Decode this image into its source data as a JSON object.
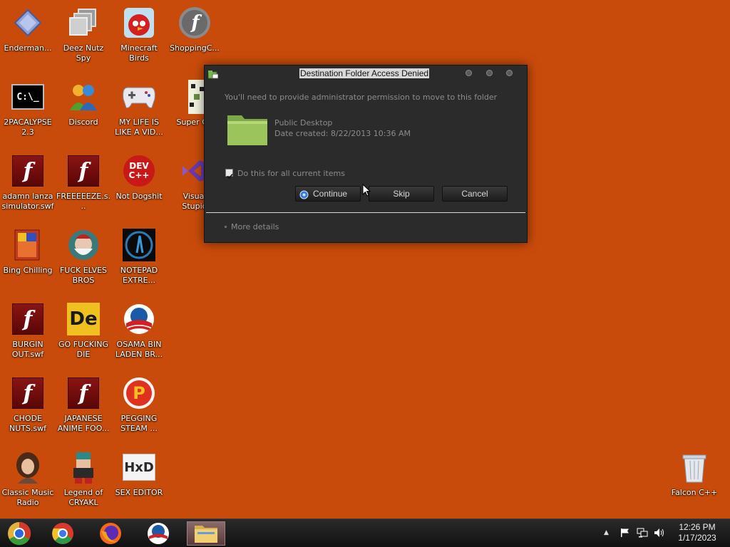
{
  "desktop": {
    "icons": [
      {
        "label": "Enderman..."
      },
      {
        "label": "Deez Nutz\nSpy"
      },
      {
        "label": "Minecraft\nBirds"
      },
      {
        "label": "ShoppingC..."
      },
      {
        "label": "2PACALYPSE\n2.3"
      },
      {
        "label": "Discord"
      },
      {
        "label": "MY LIFE IS\nLIKE A VID..."
      },
      {
        "label": "Super CR"
      },
      {
        "label": "adamn lanza\nsimulator.swf"
      },
      {
        "label": "FREEEEEZE.s..."
      },
      {
        "label": "Not Dogshit"
      },
      {
        "label": "Visual\nStupid"
      },
      {
        "label": "Bing Chilling"
      },
      {
        "label": "FUCK ELVES\nBROS"
      },
      {
        "label": "NOTEPAD\nEXTRE..."
      },
      {
        "label": "BURGIN\nOUT.swf"
      },
      {
        "label": "GO FUCKING\nDIE"
      },
      {
        "label": "OSAMA BIN\nLADEN BR..."
      },
      {
        "label": "CHODE\nNUTS.swf"
      },
      {
        "label": "JAPANESE\nANIME FOO..."
      },
      {
        "label": "PEGGING\nSTEAM ..."
      },
      {
        "label": "Classic Music\nRadio"
      },
      {
        "label": "Legend of\nCRYAKL"
      },
      {
        "label": "SEX EDITOR"
      },
      {
        "label": "Falcon C++"
      }
    ],
    "glyphs": {
      "cmd": "C:\\_",
      "dev": "DEV\nC++",
      "de": "De",
      "hxd": "HxD",
      "flash": "f"
    }
  },
  "dialog": {
    "title": "Destination Folder Access Denied",
    "message": "You'll need to provide administrator permission to move to this folder",
    "folder_name": "Public Desktop",
    "date_created": "Date created: 8/22/2013 10:36 AM",
    "checkbox_label": "Do this for all current items",
    "checkbox_checked": true,
    "continue_label": "Continue",
    "skip_label": "Skip",
    "cancel_label": "Cancel",
    "more_details": "More details"
  },
  "taskbar": {
    "items": [
      "start-orb",
      "chrome",
      "firefox",
      "obama",
      "file-explorer"
    ],
    "clock_time": "12:26 PM",
    "clock_date": "1/17/2023"
  },
  "colors": {
    "desktop_bg": "#c94b0b",
    "dialog_bg": "#2b2b2b",
    "taskbar_bg": "#1a1a1a"
  }
}
